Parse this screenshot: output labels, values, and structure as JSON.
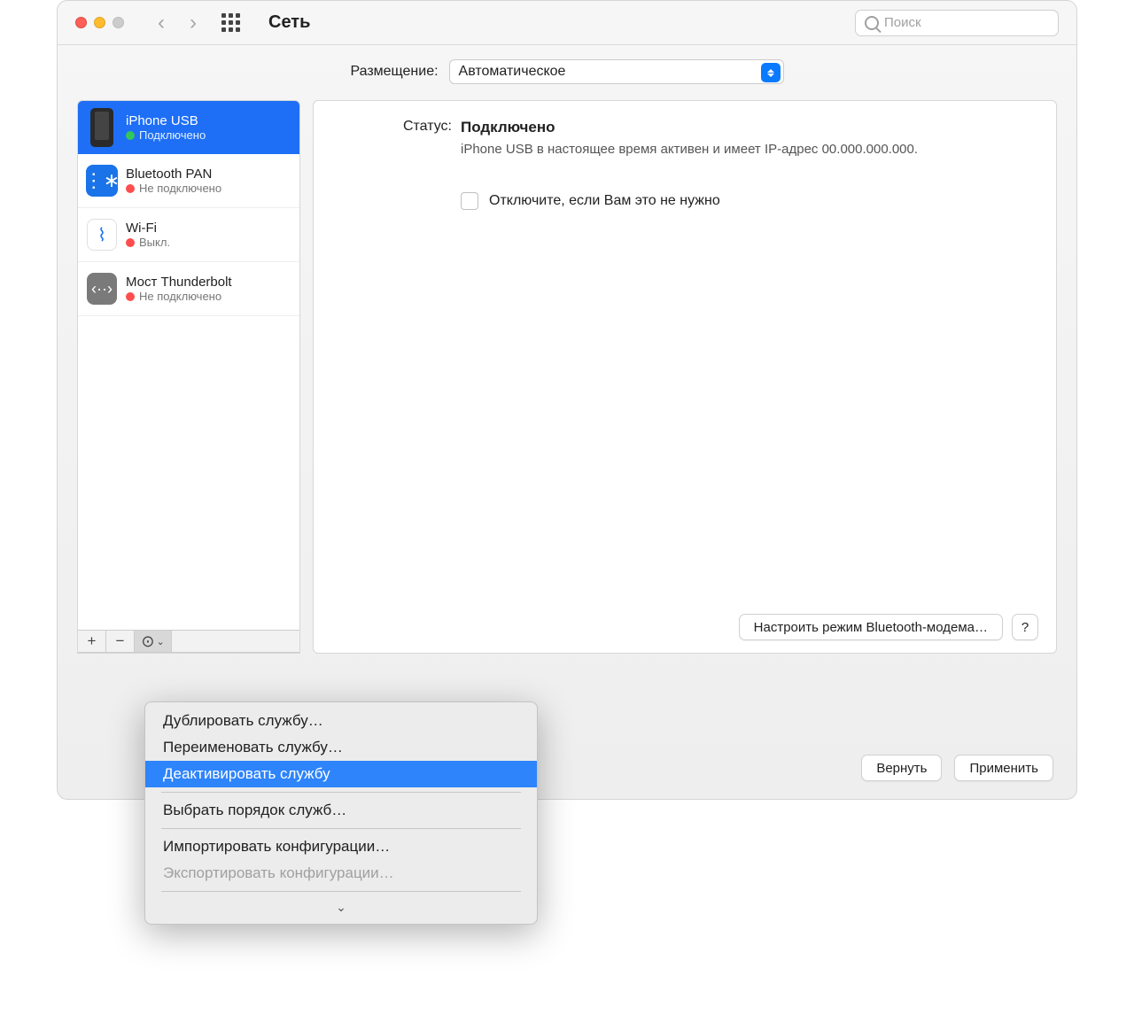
{
  "title": "Сеть",
  "search_placeholder": "Поиск",
  "location_label": "Размещение:",
  "location_value": "Автоматическое",
  "services": [
    {
      "name": "iPhone USB",
      "status": "Подключено",
      "color": "green"
    },
    {
      "name": "Bluetooth PAN",
      "status": "Не подключено",
      "color": "red"
    },
    {
      "name": "Wi-Fi",
      "status": "Выкл.",
      "color": "red"
    },
    {
      "name": "Мост Thunderbolt",
      "status": "Не подключено",
      "color": "red"
    }
  ],
  "detail": {
    "status_label": "Статус:",
    "status_value": "Подключено",
    "status_desc": "iPhone USB в настоящее время активен и имеет IP-адрес 00.000.000.000.",
    "checkbox_label": "Отключите, если Вам это не нужно",
    "configure_btn": "Настроить режим Bluetooth-модема…",
    "help": "?"
  },
  "footer": {
    "revert": "Вернуть",
    "apply": "Применить"
  },
  "menu": {
    "duplicate": "Дублировать службу…",
    "rename": "Переименовать службу…",
    "deactivate": "Деактивировать службу",
    "order": "Выбрать порядок служб…",
    "import": "Импортировать конфигурации…",
    "export": "Экспортировать конфигурации…"
  }
}
